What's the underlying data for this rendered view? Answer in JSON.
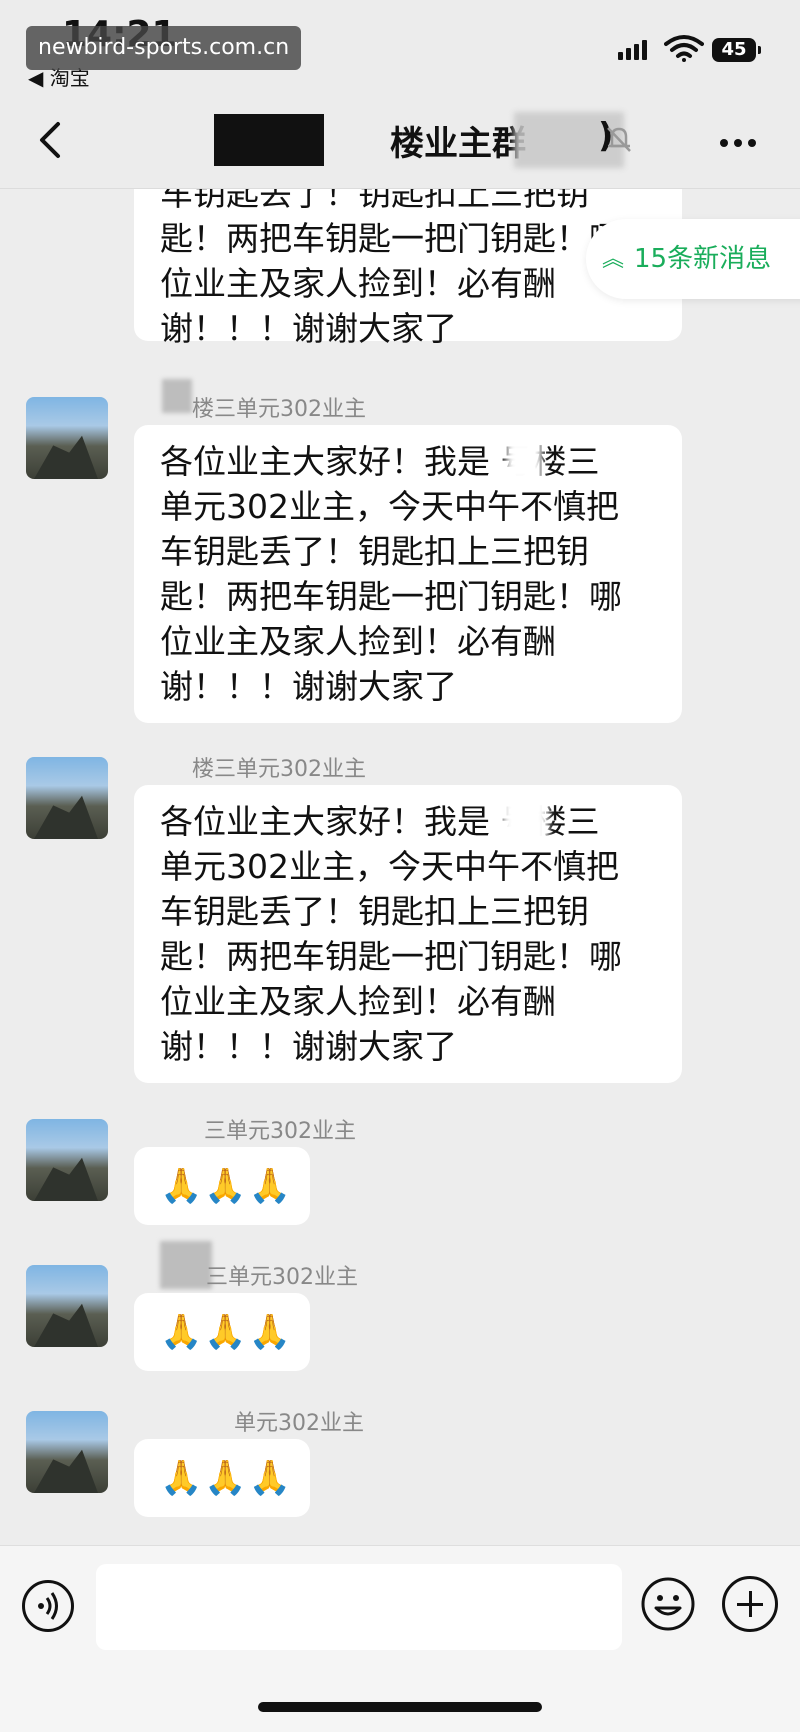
{
  "status_bar": {
    "time": "14:21",
    "back_app": "◀ 淘宝",
    "battery": "45",
    "watermark": "newbird-sports.com.cn"
  },
  "header": {
    "title": "楼业主群",
    "title_suffix": ")"
  },
  "new_messages_badge": "15条新消息",
  "messages": [
    {
      "sender": "",
      "text": "车钥匙丢了！钥匙扣上三把钥\n匙！两把车钥匙一把门钥匙！哪\n位业主及家人捡到！必有酬\n谢！！！谢谢大家了"
    },
    {
      "sender": "楼三单元302业主",
      "text": "各位业主大家好！我是  号楼三\n单元302业主，今天中午不慎把\n车钥匙丢了！钥匙扣上三把钥\n匙！两把车钥匙一把门钥匙！哪\n位业主及家人捡到！必有酬\n谢！！！谢谢大家了"
    },
    {
      "sender": "楼三单元302业主",
      "text": "各位业主大家好！我是  号楼三\n单元302业主，今天中午不慎把\n车钥匙丢了！钥匙扣上三把钥\n匙！两把车钥匙一把门钥匙！哪\n位业主及家人捡到！必有酬\n谢！！！谢谢大家了"
    },
    {
      "sender": "三单元302业主",
      "text": "🙏🙏🙏"
    },
    {
      "sender": "三单元302业主",
      "text": "🙏🙏🙏"
    },
    {
      "sender": "单元302业主",
      "text": "🙏🙏🙏"
    }
  ],
  "input_bar": {
    "placeholder": ""
  },
  "colors": {
    "accent_green": "#1aad5b",
    "background": "#ededed"
  }
}
